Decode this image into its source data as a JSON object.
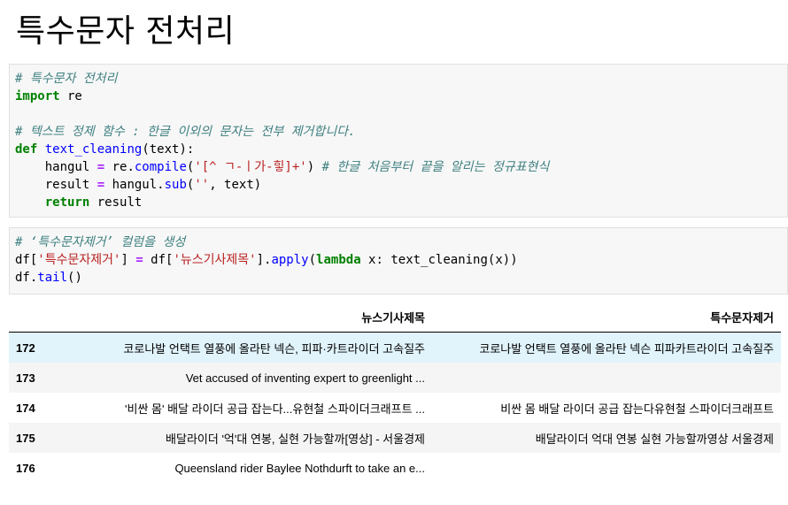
{
  "heading": "특수문자 전처리",
  "cell1": {
    "comment1": "# 특수문자 전처리",
    "import_kw": "import",
    "import_mod": " re",
    "comment2": "# 텍스트 정제 함수 : 한글 이외의 문자는 전부 제거합니다.",
    "def_kw": "def",
    "func_name": "text_cleaning",
    "def_args": "(text):",
    "l5_indent": "    hangul ",
    "eq": "=",
    "l5_mid": " re.",
    "compile_fn": "compile",
    "paren_open": "(",
    "regex": "'[^ ㄱ-ㅣ가-힣]+'",
    "paren_close": ") ",
    "comment3": "# 한글 처음부터 끝을 알리는 정규표현식",
    "l6_indent": "    result ",
    "l6_mid": " hangul.",
    "sub_fn": "sub",
    "l6_args_open": "(",
    "empty_str": "''",
    "l6_args_close": ", text)",
    "l7_indent": "    ",
    "return_kw": "return",
    "return_val": " result"
  },
  "cell2": {
    "comment": "# ‘특수문자제거’ 컬럼을 생성",
    "df1": "df[",
    "col_new": "'특수문자제거'",
    "df1_close": "] ",
    "eq": "=",
    "df2": " df[",
    "col_src": "'뉴스기사제목'",
    "df2_close": "].",
    "apply_fn": "apply",
    "apply_open": "(",
    "lambda_kw": "lambda",
    "lambda_body": " x: text_cleaning(x))",
    "tail_obj": "df.",
    "tail_fn": "tail",
    "tail_args": "()"
  },
  "table": {
    "columns": [
      "뉴스기사제목",
      "특수문자제거"
    ],
    "rows": [
      {
        "index": "172",
        "title": "코로나발 언택트 열풍에 올라탄 넥슨, 피파·카트라이더 고속질주",
        "clean": "코로나발 언택트 열풍에 올라탄 넥슨 피파카트라이더 고속질주"
      },
      {
        "index": "173",
        "title": "Vet accused of inventing expert to greenlight ...",
        "clean": ""
      },
      {
        "index": "174",
        "title": "'비싼 몸' 배달 라이더 공급 잡는다...유현철 스파이더크래프트 ...",
        "clean": "비싼 몸 배달 라이더 공급 잡는다유현철 스파이더크래프트"
      },
      {
        "index": "175",
        "title": "배달라이더 '억'대 연봉, 실현 가능할까[영상] - 서울경제",
        "clean": "배달라이더 억대 연봉 실현 가능할까영상 서울경제"
      },
      {
        "index": "176",
        "title": "Queensland rider Baylee Nothdurft to take an e...",
        "clean": ""
      }
    ]
  }
}
